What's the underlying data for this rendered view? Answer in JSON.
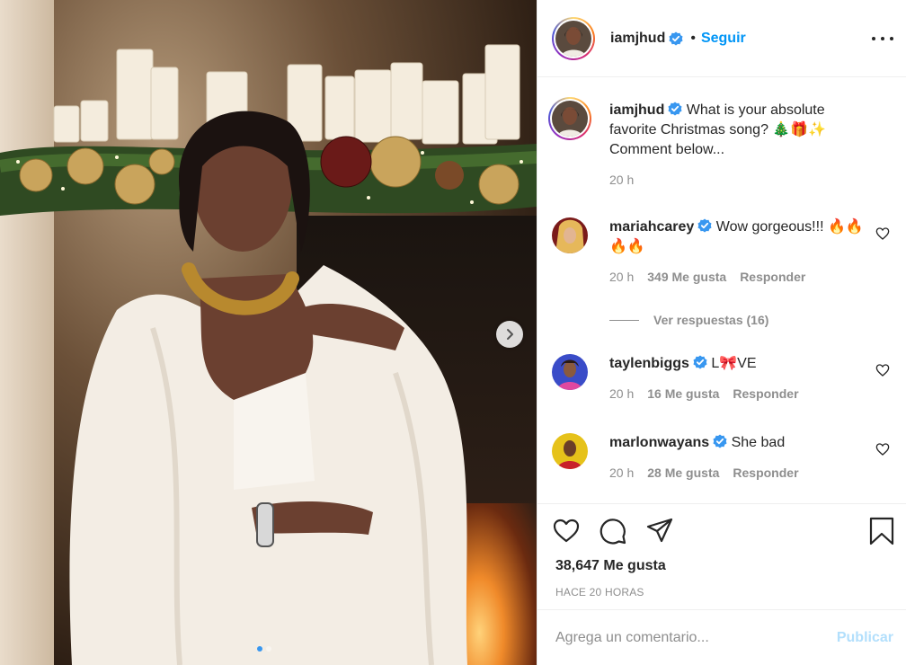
{
  "post": {
    "author": "iamjhud",
    "follow_label": "Seguir",
    "separator": "•",
    "caption_text": "What is your absolute favorite Christmas song? 🎄🎁✨ Comment below...",
    "caption_time": "20 h"
  },
  "comments": [
    {
      "user": "mariahcarey",
      "text": "Wow gorgeous!!! 🔥🔥🔥🔥",
      "time": "20 h",
      "likes": "349 Me gusta",
      "reply_label": "Responder",
      "view_replies": "Ver respuestas (16)"
    },
    {
      "user": "taylenbiggs",
      "text": "L🎀VE",
      "time": "20 h",
      "likes": "16 Me gusta",
      "reply_label": "Responder"
    },
    {
      "user": "marlonwayans",
      "text": "She bad",
      "time": "20 h",
      "likes": "28 Me gusta",
      "reply_label": "Responder"
    }
  ],
  "engagement": {
    "likes": "38,647 Me gusta",
    "time_ago": "HACE 20 HORAS"
  },
  "composer": {
    "placeholder": "Agrega un comentario...",
    "publish_label": "Publicar"
  },
  "carousel": {
    "current_slide": 1,
    "total_slides": 2
  },
  "icons": {
    "verified": "verified-badge-icon",
    "more": "more-options-icon",
    "next": "chevron-right-icon",
    "like": "heart-icon",
    "comment": "comment-bubble-icon",
    "share": "paper-plane-icon",
    "save": "bookmark-icon"
  },
  "colors": {
    "accent": "#0095f6",
    "verified": "#3897f0",
    "muted": "#8e8e8e",
    "publish_disabled": "#b2dffc"
  }
}
